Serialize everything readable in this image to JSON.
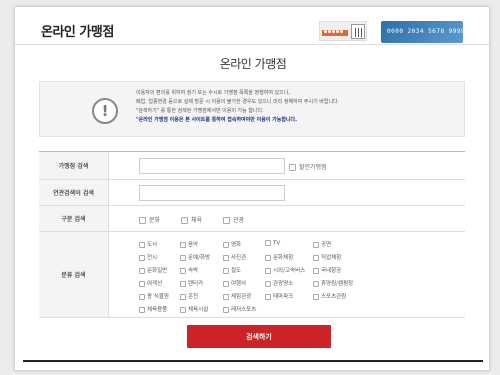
{
  "header": {
    "app_title": "온라인 가맹점",
    "banner_dots": "●●●●●",
    "card_number": "0000 2034 5678 9999"
  },
  "page": {
    "title": "온라인 가맹점"
  },
  "notice": {
    "icon": "exclamation-icon",
    "lines": [
      "이용자의 편의를 위하여 정기 또는 수시로 가맹점 목록을 정행하여 있으나,",
      "폐업, 업종변경 등으로 실제 방문 시 이용이 불가한 경우도 있으니 미리 정해하여 주시기 바랍니다.",
      "\"검색하기\" 를 통한 검색된 가맹점에서만 이용이 가능 합니다."
    ],
    "highlight": "\"온라인 가맹점 이용은 본 사이트를 통하여 접속하여야만 이용이 가능합니다."
  },
  "form": {
    "store_search": {
      "label": "가맹점 검색",
      "value": "",
      "option_label": "할인가맹점"
    },
    "keyword_search": {
      "label": "연관검색어 검색",
      "value": ""
    },
    "type_search": {
      "label": "구분 검색",
      "options": [
        "문화",
        "체육",
        "관광"
      ]
    },
    "category_search": {
      "label": "분류 검색",
      "rows": [
        [
          "도서",
          "음악",
          "영화",
          "TV",
          "공연"
        ],
        [
          "전시",
          "문예/화방",
          "사진관",
          "문화체험",
          "직업체험"
        ],
        [
          "문화일반",
          "숙박",
          "철도",
          "시외/고속버스",
          "국내항공"
        ],
        [
          "여객선",
          "렌터카",
          "여행사",
          "관광명소",
          "휴양림/캠핑장"
        ],
        [
          "종 식물원",
          "온천",
          "체험관광",
          "테마파크",
          "스포츠관람"
        ],
        [
          "체육용품",
          "체육시설",
          "레저스포츠"
        ]
      ]
    }
  },
  "search_button": {
    "label": "검색하기"
  },
  "colors": {
    "accent": "#cc2328",
    "notice_highlight": "#1f2d8c"
  }
}
